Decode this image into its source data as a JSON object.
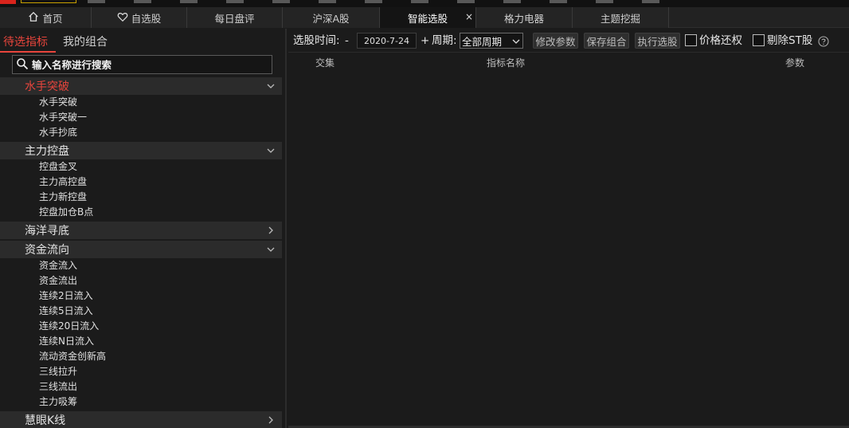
{
  "tabs": [
    {
      "label": "首页",
      "icon": "home-icon"
    },
    {
      "label": "自选股",
      "icon": "heart-icon"
    },
    {
      "label": "每日盘评"
    },
    {
      "label": "沪深A股"
    },
    {
      "label": "智能选股",
      "active": true,
      "close": "×"
    },
    {
      "label": "格力电器"
    },
    {
      "label": "主题挖掘"
    }
  ],
  "left": {
    "subtabs": [
      "待选指标",
      "我的组合"
    ],
    "search_placeholder": "输入名称进行搜索",
    "groups": [
      {
        "label": "水手突破",
        "expanded": true,
        "active": true,
        "items": [
          "水手突破",
          "水手突破一",
          "水手抄底"
        ]
      },
      {
        "label": "主力控盘",
        "expanded": true,
        "items": [
          "控盘金叉",
          "主力高控盘",
          "主力新控盘",
          "控盘加仓B点"
        ]
      },
      {
        "label": "海洋寻底",
        "expanded": false,
        "items": []
      },
      {
        "label": "资金流向",
        "expanded": true,
        "items": [
          "资金流入",
          "资金流出",
          "连续2日流入",
          "连续5日流入",
          "连续20日流入",
          "连续N日流入",
          "流动资金创新高",
          "三线拉升",
          "三线流出",
          "主力吸筹"
        ]
      },
      {
        "label": "慧眼K线",
        "expanded": false,
        "items": []
      }
    ]
  },
  "toolbar": {
    "date_label": "选股时间:",
    "minus": "-",
    "date_value": "2020-7-24",
    "plus": "+",
    "period_label": "周期:",
    "period_value": "全部周期",
    "modify_button": "修改参数",
    "save_button": "保存组合",
    "execute_button": "执行选股",
    "price_restore": "价格还权",
    "exclude_st": "剔除ST股"
  },
  "table": {
    "headers": [
      "交集",
      "指标名称",
      "参数"
    ]
  },
  "colors": {
    "accent": "#e8453c",
    "background": "#1b1b1b",
    "group_background": "#2b2b2b"
  }
}
